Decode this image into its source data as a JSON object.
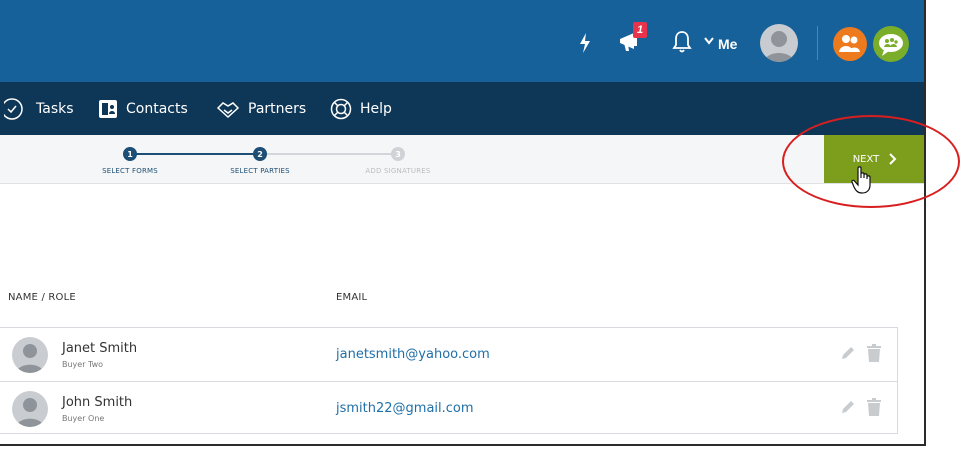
{
  "header": {
    "me_label": "Me",
    "notification_count": "1"
  },
  "nav": {
    "items": [
      {
        "label": "Tasks"
      },
      {
        "label": "Contacts"
      },
      {
        "label": "Partners"
      },
      {
        "label": "Help"
      }
    ]
  },
  "wizard": {
    "steps": [
      {
        "number": "1",
        "label": "SELECT FORMS"
      },
      {
        "number": "2",
        "label": "SELECT PARTIES"
      },
      {
        "number": "3",
        "label": "ADD SIGNATURES"
      }
    ],
    "next_label": "NEXT"
  },
  "table": {
    "headers": {
      "name_role": "NAME / ROLE",
      "email": "EMAIL"
    },
    "rows": [
      {
        "name": "Janet Smith",
        "role": "Buyer Two",
        "email": "janetsmith@yahoo.com"
      },
      {
        "name": "John Smith",
        "role": "Buyer One",
        "email": "jsmith22@gmail.com"
      }
    ]
  },
  "colors": {
    "topbar": "#17619a",
    "navbar": "#0e3656",
    "next_button": "#7d9e1d",
    "annotation": "#d81f1f",
    "badge": "#e8334a"
  }
}
